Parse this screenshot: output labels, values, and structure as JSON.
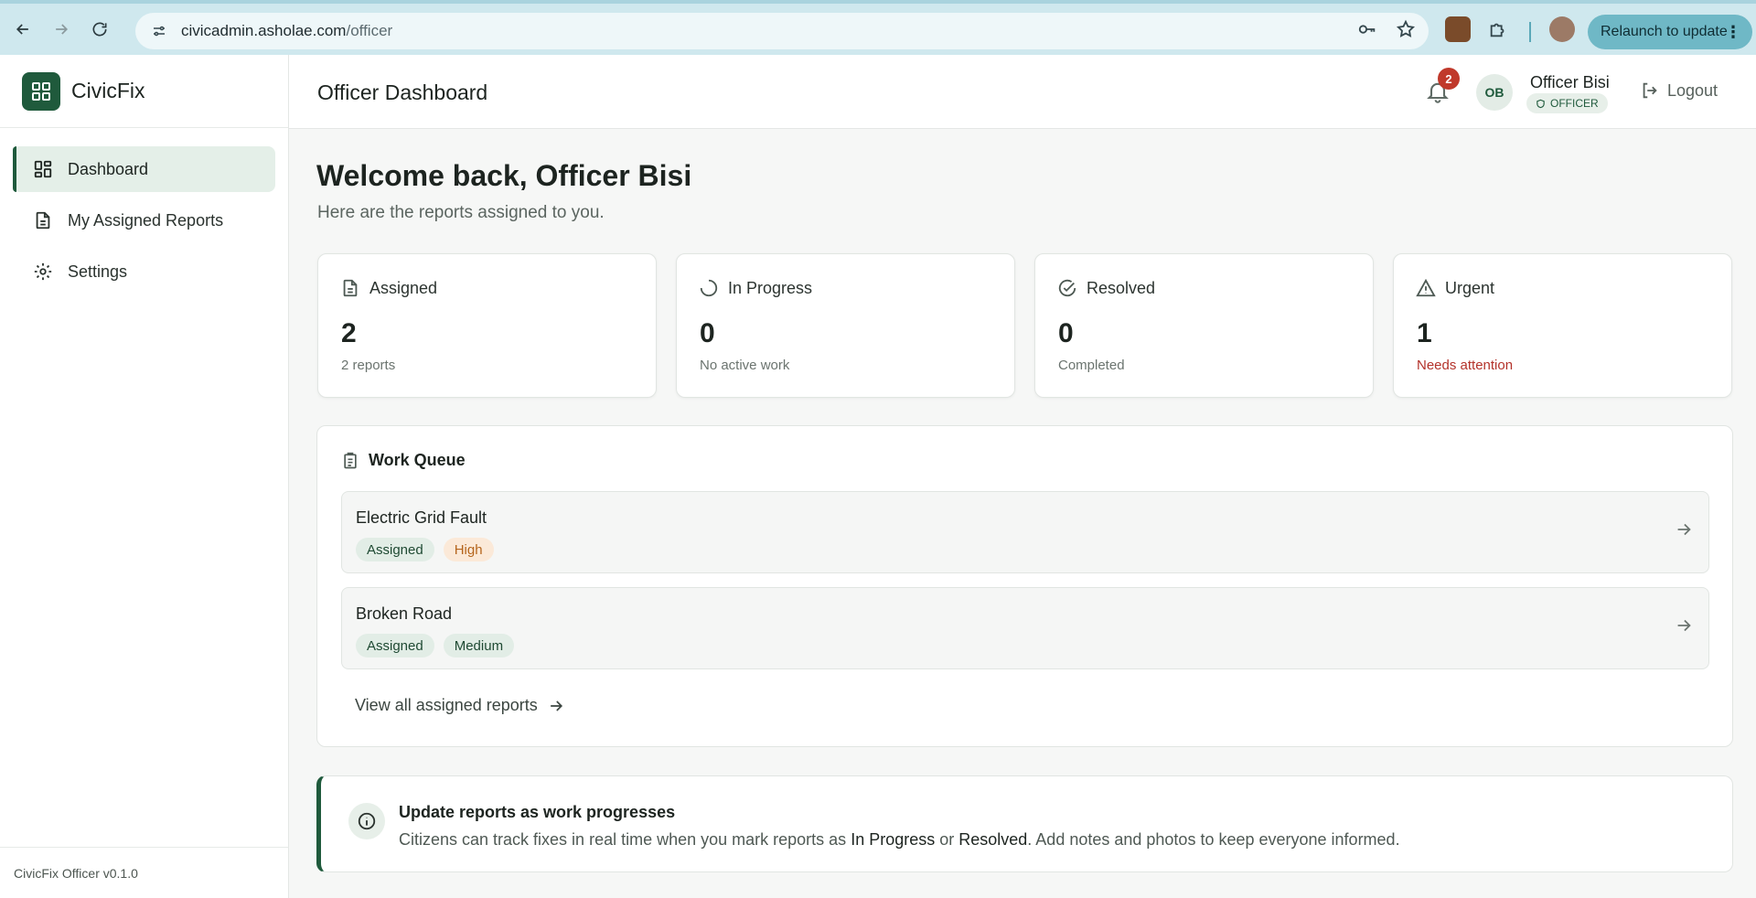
{
  "browser": {
    "url_host": "civicadmin.asholae.com",
    "url_path": "/officer",
    "relaunch_label": "Relaunch to update"
  },
  "sidebar": {
    "brand": "CivicFix",
    "items": [
      {
        "label": "Dashboard",
        "icon": "dashboard-icon",
        "active": true
      },
      {
        "label": "My Assigned Reports",
        "icon": "document-icon",
        "active": false
      },
      {
        "label": "Settings",
        "icon": "gear-icon",
        "active": false
      }
    ],
    "footer": "CivicFix Officer v0.1.0"
  },
  "header": {
    "title": "Officer Dashboard",
    "notification_count": "2",
    "avatar_initials": "OB",
    "user_name": "Officer Bisi",
    "role": "OFFICER",
    "logout_label": "Logout"
  },
  "main": {
    "welcome": "Welcome back, Officer Bisi",
    "subtitle": "Here are the reports assigned to you.",
    "stats": [
      {
        "label": "Assigned",
        "value": "2",
        "note": "2 reports",
        "icon": "document-icon"
      },
      {
        "label": "In Progress",
        "value": "0",
        "note": "No active work",
        "icon": "spinner-icon"
      },
      {
        "label": "Resolved",
        "value": "0",
        "note": "Completed",
        "icon": "check-circle-icon"
      },
      {
        "label": "Urgent",
        "value": "1",
        "note": "Needs attention",
        "icon": "warning-icon",
        "note_color": "#b3322a"
      }
    ],
    "queue": {
      "title": "Work Queue",
      "items": [
        {
          "title": "Electric Grid Fault",
          "status": "Assigned",
          "priority": "High"
        },
        {
          "title": "Broken Road",
          "status": "Assigned",
          "priority": "Medium"
        }
      ],
      "view_all": "View all assigned reports"
    },
    "info": {
      "title": "Update reports as work progresses",
      "text_before": "Citizens can track fixes in real time when you mark reports as ",
      "term1": "In Progress",
      "text_mid": " or ",
      "term2": "Resolved",
      "text_after": ". Add notes and photos to keep everyone informed."
    }
  },
  "colors": {
    "brand": "#1f5a3c",
    "urgent": "#b3322a",
    "badge": "#c0392b"
  }
}
